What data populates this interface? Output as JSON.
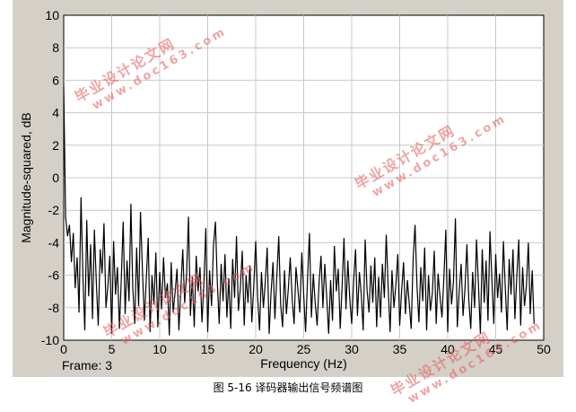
{
  "chart_data": {
    "type": "line",
    "xlabel": "Frequency (Hz)",
    "ylabel": "Magnitude-squared, dB",
    "xlim": [
      0,
      50
    ],
    "ylim": [
      -10,
      10
    ],
    "xticks": [
      "0",
      "5",
      "10",
      "15",
      "20",
      "25",
      "30",
      "35",
      "40",
      "45",
      "50"
    ],
    "yticks": [
      "10",
      "8",
      "6",
      "4",
      "2",
      "0",
      "-2",
      "-4",
      "-6",
      "-8",
      "-10"
    ],
    "grid": true,
    "series": [
      {
        "color": "#000000",
        "x": [
          0,
          0.2,
          0.4,
          0.6,
          0.8,
          1.0,
          1.2,
          1.4,
          1.6,
          1.8,
          2.0,
          2.2,
          2.4,
          2.6,
          2.8,
          3.0,
          3.2,
          3.4,
          3.6,
          3.8,
          4.0,
          4.2,
          4.4,
          4.6,
          4.8,
          5.0,
          5.2,
          5.4,
          5.6,
          5.8,
          6.0,
          6.2,
          6.4,
          6.6,
          6.8,
          7.0,
          7.2,
          7.4,
          7.6,
          7.8,
          8.0,
          8.2,
          8.4,
          8.6,
          8.8,
          9.0,
          9.2,
          9.4,
          9.6,
          9.8,
          10.0,
          10.2,
          10.4,
          10.6,
          10.8,
          11.0,
          11.2,
          11.4,
          11.6,
          11.8,
          12.0,
          12.2,
          12.4,
          12.6,
          12.8,
          13.0,
          13.2,
          13.4,
          13.6,
          13.8,
          14.0,
          14.2,
          14.4,
          14.6,
          14.8,
          15.0,
          15.2,
          15.4,
          15.6,
          15.8,
          16.0,
          16.2,
          16.4,
          16.6,
          16.8,
          17.0,
          17.2,
          17.4,
          17.6,
          17.8,
          18.0,
          18.2,
          18.4,
          18.6,
          18.8,
          19.0,
          19.2,
          19.4,
          19.6,
          19.8,
          20.0,
          20.2,
          20.4,
          20.6,
          20.8,
          21.0,
          21.2,
          21.4,
          21.6,
          21.8,
          22.0,
          22.2,
          22.4,
          22.6,
          22.8,
          23.0,
          23.2,
          23.4,
          23.6,
          23.8,
          24.0,
          24.2,
          24.4,
          24.6,
          24.8,
          25.0,
          25.2,
          25.4,
          25.6,
          25.8,
          26.0,
          26.2,
          26.4,
          26.6,
          26.8,
          27.0,
          27.2,
          27.4,
          27.6,
          27.8,
          28.0,
          28.2,
          28.4,
          28.6,
          28.8,
          29.0,
          29.2,
          29.4,
          29.6,
          29.8,
          30.0,
          30.2,
          30.4,
          30.6,
          30.8,
          31.0,
          31.2,
          31.4,
          31.6,
          31.8,
          32.0,
          32.2,
          32.4,
          32.6,
          32.8,
          33.0,
          33.2,
          33.4,
          33.6,
          33.8,
          34.0,
          34.2,
          34.4,
          34.6,
          34.8,
          35.0,
          35.2,
          35.4,
          35.6,
          35.8,
          36.0,
          36.2,
          36.4,
          36.6,
          36.8,
          37.0,
          37.2,
          37.4,
          37.6,
          37.8,
          38.0,
          38.2,
          38.4,
          38.6,
          38.8,
          39.0,
          39.2,
          39.4,
          39.6,
          39.8,
          40.0,
          40.2,
          40.4,
          40.6,
          40.8,
          41.0,
          41.2,
          41.4,
          41.6,
          41.8,
          42.0,
          42.2,
          42.4,
          42.6,
          42.8,
          43.0,
          43.2,
          43.4,
          43.6,
          43.8,
          44.0,
          44.2,
          44.4,
          44.6,
          44.8,
          45.0,
          45.2,
          45.4,
          45.6,
          45.8,
          46.0,
          46.2,
          46.4,
          46.6,
          46.8,
          47.0,
          47.2,
          47.4,
          47.6,
          47.8,
          48.0,
          48.2,
          48.4,
          48.6,
          48.8,
          49.0
        ],
        "y": [
          5.6,
          -2.4,
          -3.6,
          -2.9,
          -5.2,
          -3.4,
          -6.8,
          -4.9,
          -8.3,
          -1.2,
          -6.0,
          -9.4,
          -2.6,
          -7.3,
          -4.1,
          -8.7,
          -3.2,
          -6.5,
          -9.1,
          -4.4,
          -5.9,
          -2.8,
          -8.0,
          -6.7,
          -4.8,
          -9.6,
          -3.9,
          -7.2,
          -5.5,
          -9.3,
          -6.2,
          -2.7,
          -8.4,
          -5.1,
          -7.6,
          -1.6,
          -6.8,
          -9.0,
          -4.3,
          -7.9,
          -2.1,
          -5.6,
          -8.8,
          -6.3,
          -3.7,
          -9.5,
          -6.0,
          -7.8,
          -4.6,
          -9.2,
          -5.8,
          -8.1,
          -4.9,
          -7.4,
          -6.5,
          -9.7,
          -5.2,
          -8.3,
          -7.1,
          -5.6,
          -9.4,
          -6.9,
          -4.4,
          -7.7,
          -5.9,
          -2.4,
          -8.5,
          -6.1,
          -9.2,
          -4.8,
          -7.0,
          -5.5,
          -8.9,
          -6.6,
          -3.1,
          -9.5,
          -5.7,
          -7.9,
          -4.2,
          -2.7,
          -6.4,
          -9.0,
          -5.3,
          -7.6,
          -4.7,
          -8.6,
          -6.2,
          -9.3,
          -5.0,
          -7.4,
          -3.6,
          -8.2,
          -6.8,
          -4.5,
          -9.1,
          -6.0,
          -7.7,
          -5.4,
          -8.9,
          -6.6,
          -3.9,
          -7.3,
          -9.4,
          -5.8,
          -8.0,
          -6.4,
          -4.3,
          -9.6,
          -7.1,
          -5.2,
          -8.7,
          -6.1,
          -3.6,
          -7.8,
          -9.2,
          -5.7,
          -8.4,
          -6.8,
          -4.9,
          -7.5,
          -9.0,
          -5.5,
          -6.9,
          -8.3,
          -4.6,
          -7.2,
          -9.5,
          -6.2,
          -3.4,
          -8.6,
          -5.9,
          -7.7,
          -9.1,
          -6.5,
          -4.8,
          -8.0,
          -5.3,
          -7.4,
          -9.6,
          -6.3,
          -8.8,
          -4.2,
          -7.0,
          -5.6,
          -9.3,
          -6.7,
          -3.7,
          -8.1,
          -5.1,
          -7.5,
          -9.0,
          -6.4,
          -4.4,
          -8.5,
          -5.8,
          -7.2,
          -9.4,
          -3.8,
          -6.9,
          -8.3,
          -5.4,
          -7.7,
          -4.9,
          -9.2,
          -6.1,
          -8.6,
          -5.3,
          -7.4,
          -3.5,
          -6.8,
          -9.5,
          -5.7,
          -8.0,
          -6.6,
          -4.7,
          -9.1,
          -7.0,
          -5.2,
          -8.4,
          -6.3,
          -7.8,
          -9.3,
          -5.0,
          -2.9,
          -6.7,
          -8.9,
          -5.5,
          -7.6,
          -4.3,
          -9.4,
          -6.0,
          -8.2,
          -7.1,
          -4.5,
          -9.0,
          -5.9,
          -7.3,
          -8.6,
          -6.2,
          -3.2,
          -9.5,
          -5.6,
          -7.8,
          -6.4,
          -2.5,
          -9.2,
          -7.0,
          -5.3,
          -8.5,
          -6.8,
          -4.1,
          -7.5,
          -9.3,
          -5.8,
          -8.0,
          -3.8,
          -6.5,
          -9.6,
          -4.4,
          -7.7,
          -5.1,
          -8.8,
          -3.3,
          -6.2,
          -9.0,
          -4.7,
          -7.4,
          -5.9,
          -8.3,
          -3.9,
          -6.8,
          -9.4,
          -5.0,
          -7.2,
          -4.4,
          -8.7,
          -6.1,
          -3.8,
          -9.1,
          -5.5,
          -7.9,
          -6.7,
          -4.0,
          -8.4,
          -5.7,
          -9.0
        ]
      }
    ]
  },
  "frame_label": "Frame: 3",
  "caption": "图 5-16 译码器输出信号频谱图",
  "watermark": {
    "text": "毕业设计论文网",
    "url": "www.doc163.com"
  }
}
